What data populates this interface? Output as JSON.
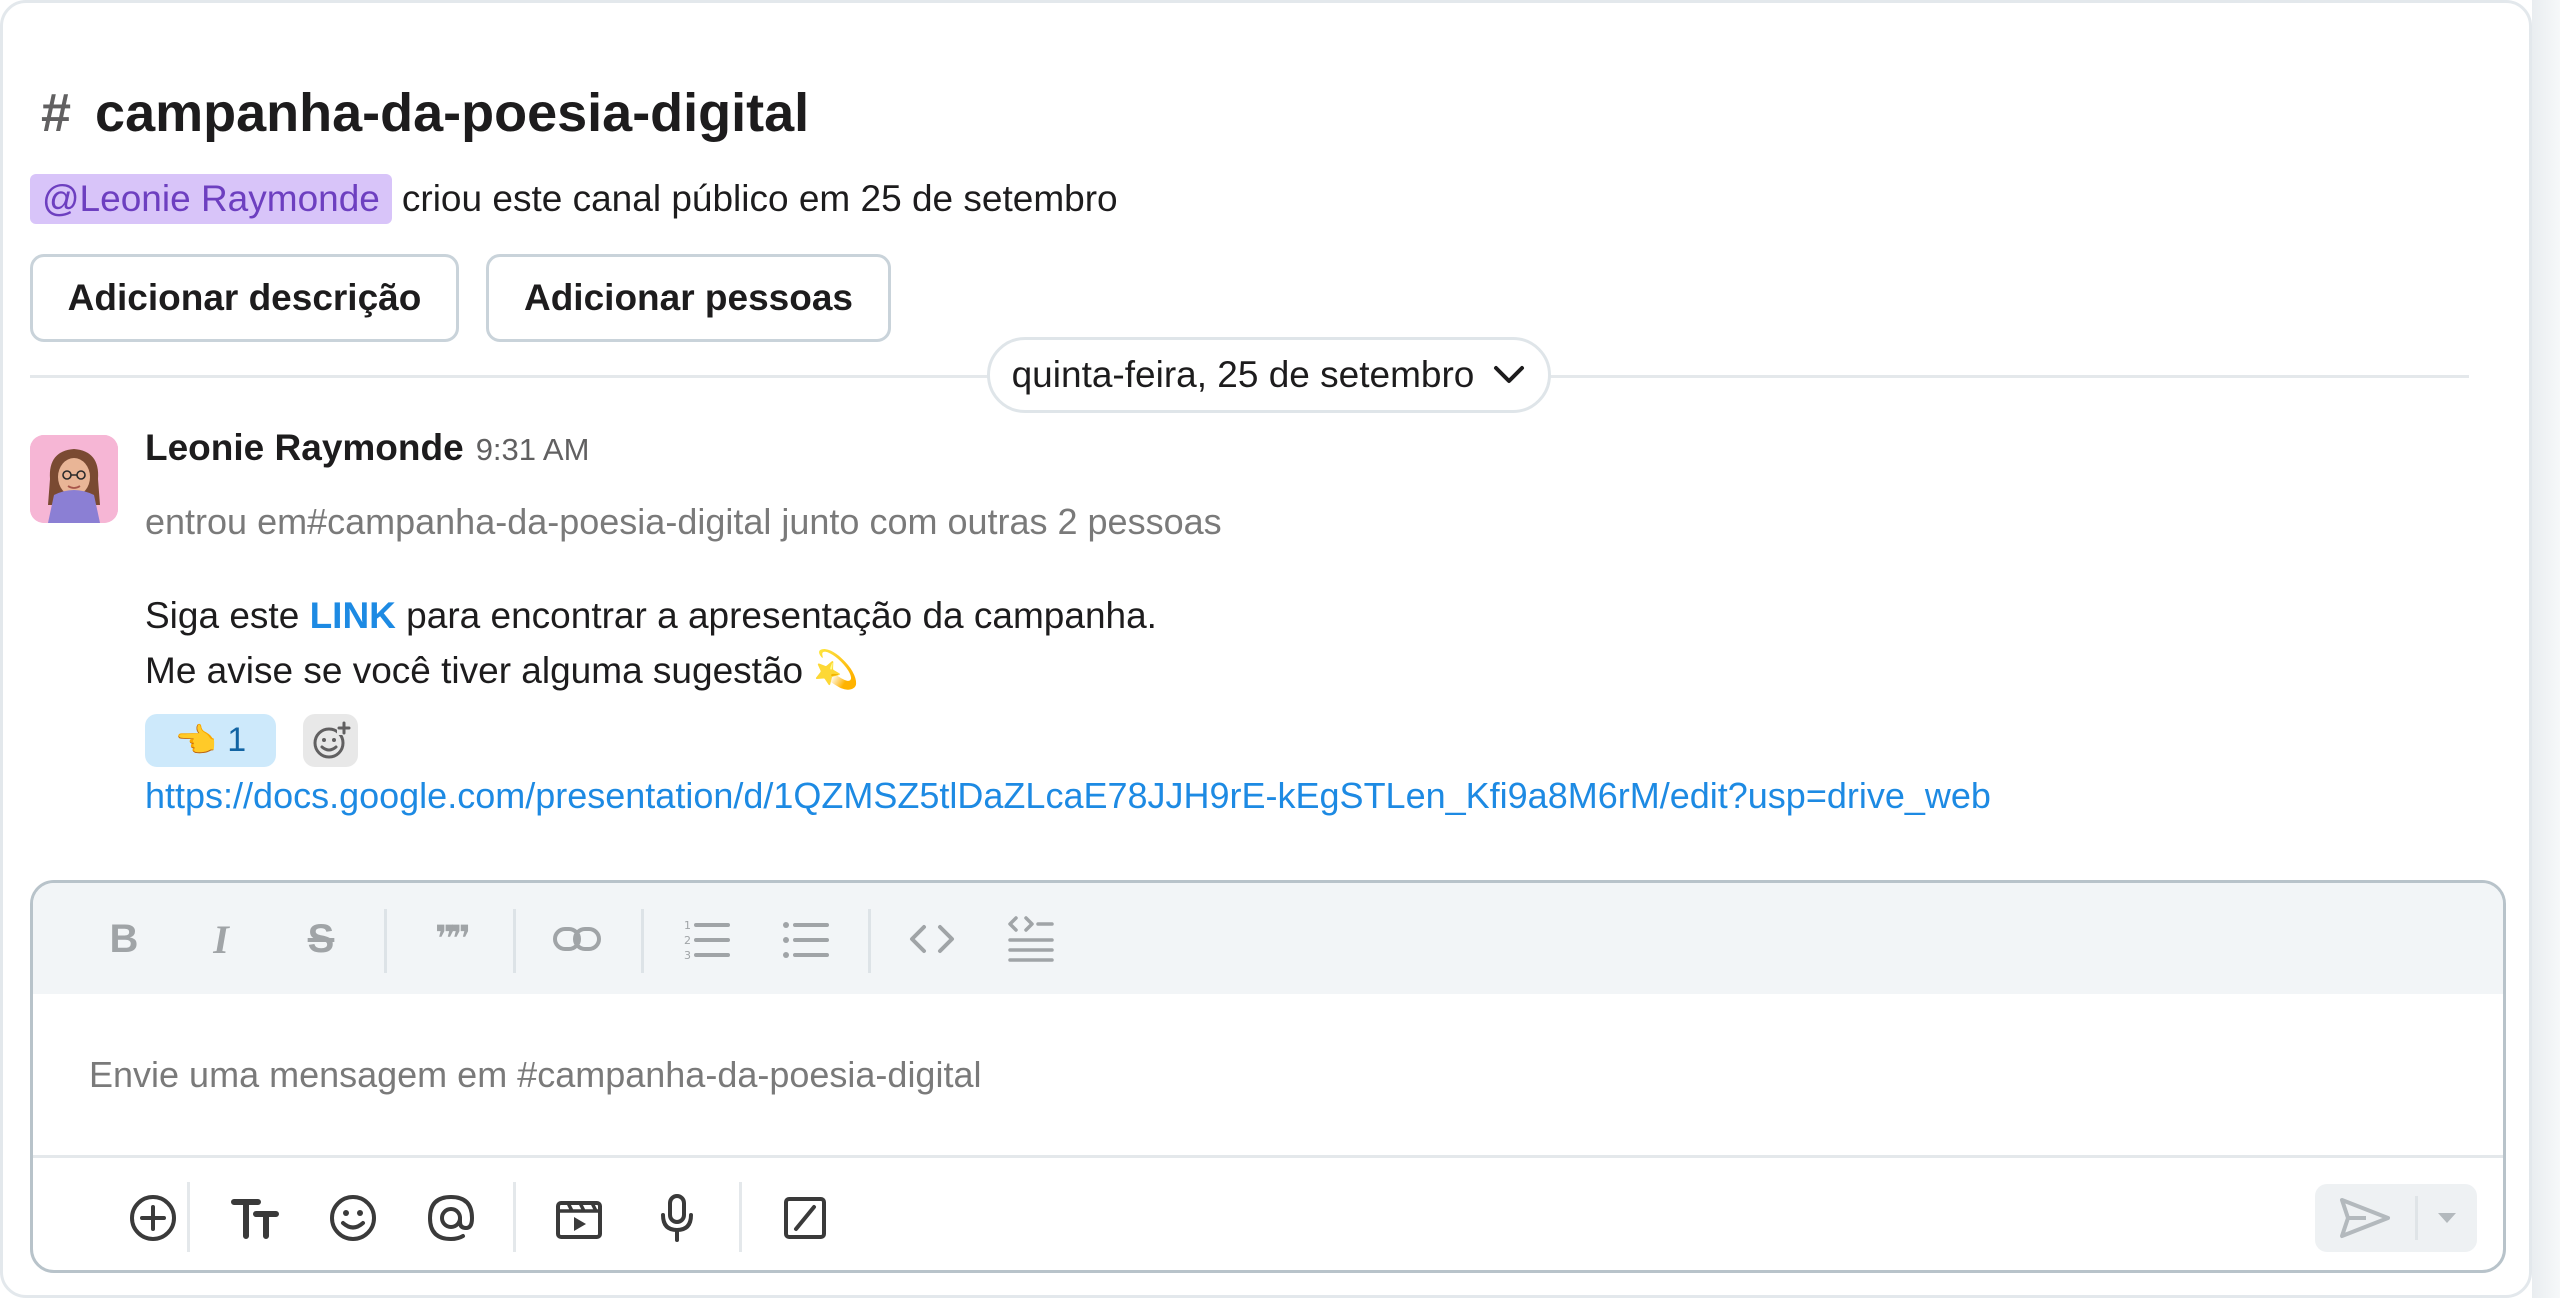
{
  "channel": {
    "name": "campanha-da-poesia-digital",
    "created_by_mention": "@Leonie Raymonde",
    "created_text": "criou este canal público em 25 de setembro",
    "add_description_label": "Adicionar descrição",
    "add_people_label": "Adicionar pessoas"
  },
  "divider": {
    "date_label": "quinta-feira, 25 de setembro"
  },
  "message": {
    "author": "Leonie Raymonde",
    "time": "9:31 AM",
    "join_text": "entrou em#campanha-da-poesia-digital junto com outras 2 pessoas",
    "line1_before": "Siga este ",
    "line1_link": "LINK",
    "line1_after": " para encontrar a apresentação da campanha.",
    "line2": "Me avise se você tiver alguma sugestão",
    "line2_emoji": "💫",
    "reaction_emoji": "👈",
    "reaction_count": "1",
    "url": "https://docs.google.com/presentation/d/1QZMSZ5tlDaZLcaE78JJH9rE-kEgSTLen_Kfi9a8M6rM/edit?usp=drive_web"
  },
  "composer": {
    "placeholder": "Envie uma mensagem em #campanha-da-poesia-digital"
  },
  "icons": {
    "hash": "#",
    "bold": "B",
    "italic": "I",
    "strike": "S",
    "quote": "❞❞",
    "emoji_icon_color": "#616061"
  },
  "colors": {
    "link": "#1d8ae3",
    "mention_bg": "#d8c4f9",
    "mention_text": "#6d3fc0",
    "reaction_bg": "#cde9fb"
  }
}
